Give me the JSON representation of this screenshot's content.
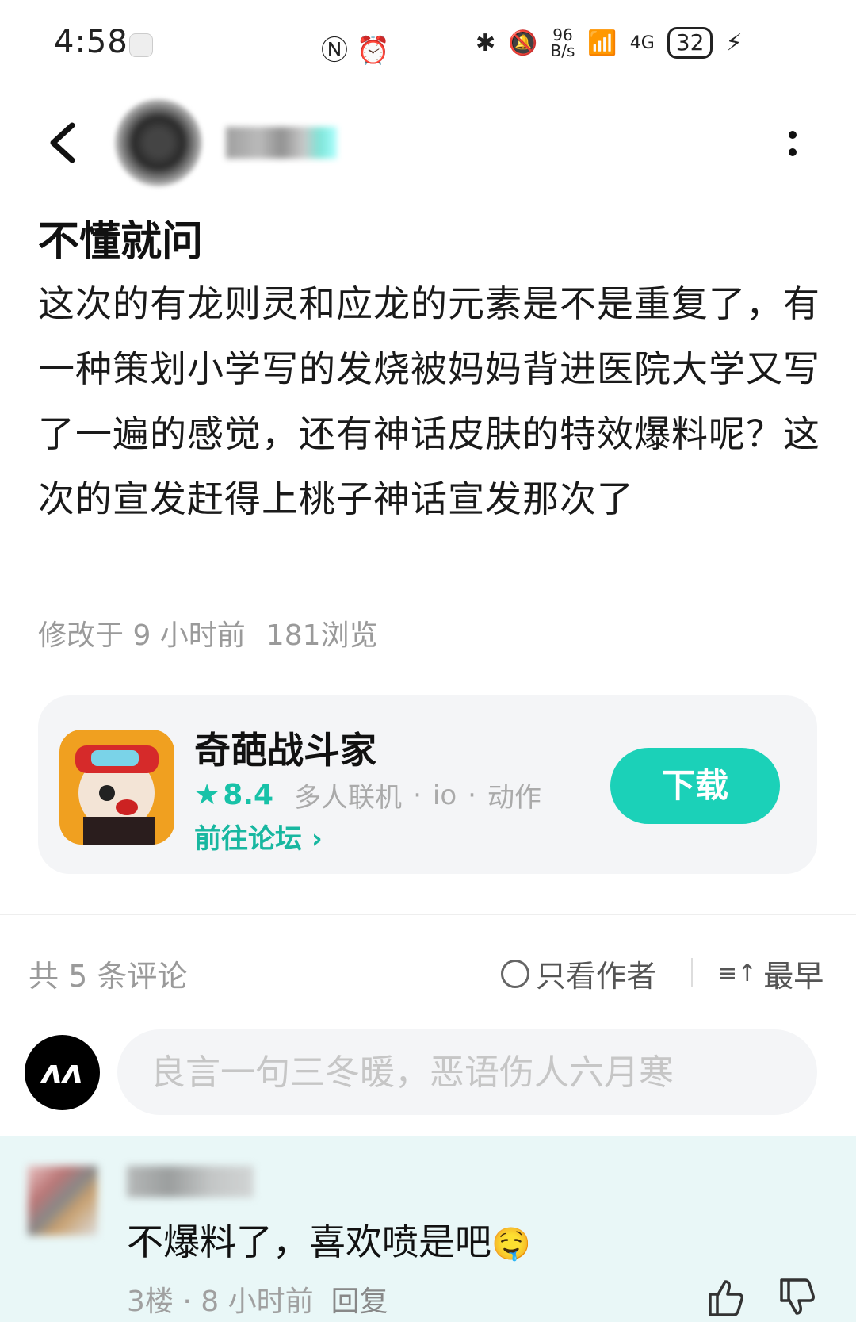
{
  "status_bar": {
    "time": "4:58",
    "net_speed_value": "96",
    "net_speed_unit": "B/s",
    "network": "4G",
    "battery": "32"
  },
  "post": {
    "title": "不懂就问",
    "body": "这次的有龙则灵和应龙的元素是不是重复了，有一种策划小学写的发烧被妈妈背进医院大学又写了一遍的感觉，还有神话皮肤的特效爆料呢？这次的宣发赶得上桃子神话宣发那次了",
    "modified": "修改于 9 小时前",
    "views": "181浏览"
  },
  "game_card": {
    "name": "奇葩战斗家",
    "rating": "8.4",
    "tags": [
      "多人联机",
      "io",
      "动作"
    ],
    "forum_link": "前往论坛",
    "download_label": "下载",
    "accent_color": "#1bd1b8"
  },
  "comments_header": {
    "count": "共 5 条评论",
    "only_author": "只看作者",
    "sort": "最早"
  },
  "input": {
    "placeholder": "良言一句三冬暖，恶语伤人六月寒"
  },
  "comment": {
    "text": "不爆料了，喜欢喷是吧",
    "emoji": "🤤",
    "floor": "3楼",
    "time": "8 小时前",
    "reply": "回复"
  },
  "icons": [
    "back-icon",
    "more-icon",
    "star-icon",
    "chevron-right-icon",
    "circle-icon",
    "sort-icon",
    "like-icon",
    "dislike-icon"
  ]
}
